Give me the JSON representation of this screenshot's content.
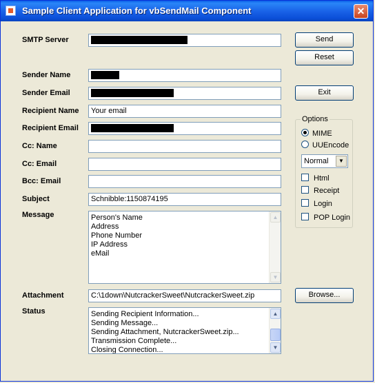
{
  "window": {
    "title": "Sample Client Application for vbSendMail Component",
    "close_symbol": "✕"
  },
  "form": {
    "smtp_server_label": "SMTP Server",
    "sender_name_label": "Sender Name",
    "sender_email_label": "Sender Email",
    "recipient_name_label": "Recipient Name",
    "recipient_name_value": "Your email",
    "recipient_email_label": "Recipient Email",
    "cc_name_label": "Cc: Name",
    "cc_email_label": "Cc: Email",
    "bcc_email_label": "Bcc: Email",
    "subject_label": "Subject",
    "subject_value": "Schnibble:1150874195",
    "message_label": "Message",
    "message_lines": [
      "Person's Name",
      "Address",
      "Phone Number",
      "IP Address",
      "eMail"
    ],
    "attachment_label": "Attachment",
    "attachment_value": "C:\\1down\\NutcrackerSweet\\NutcrackerSweet.zip",
    "status_label": "Status",
    "status_lines": [
      "Sending Recipient Information...",
      "Sending Message...",
      "Sending Attachment, NutcrackerSweet.zip...",
      "Transmission Complete...",
      "Closing Connection..."
    ]
  },
  "buttons": {
    "send": "Send",
    "reset": "Reset",
    "exit": "Exit",
    "browse": "Browse..."
  },
  "options": {
    "title": "Options",
    "mime": "MIME",
    "uuencode": "UUEncode",
    "priority_selected": "Normal",
    "html": "Html",
    "receipt": "Receipt",
    "login": "Login",
    "pop_login": "POP Login"
  }
}
